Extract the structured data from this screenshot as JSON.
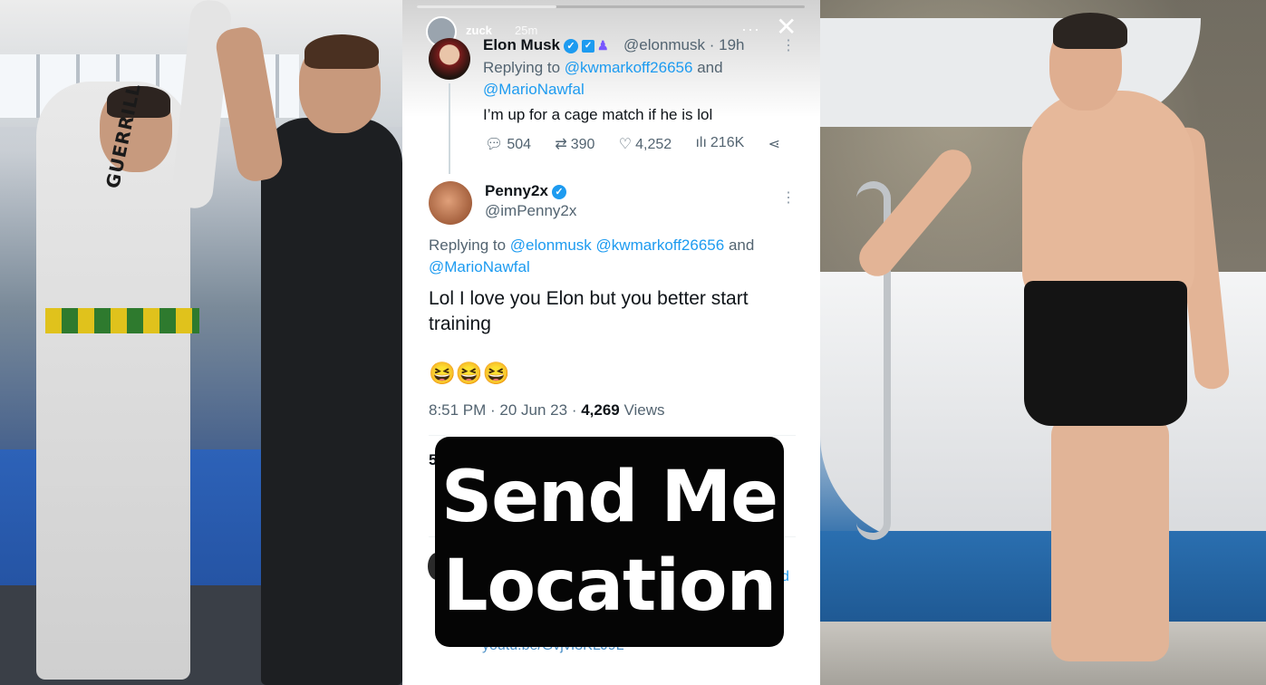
{
  "story": {
    "username": "zuck",
    "time": "25m",
    "progress": 0.36,
    "more_label": "···",
    "close_label": "✕"
  },
  "tweet1": {
    "name": "Elon Musk",
    "handle_time": "@elonmusk · 19h",
    "replying_prefix": "Replying to ",
    "replying_users": [
      "@kwmarkoff26656",
      "@MarioNawfal"
    ],
    "replying_and": " and",
    "text": "I’m up for a cage match if he is lol",
    "replies": "504",
    "retweets": "390",
    "likes": "4,252",
    "views": "216K"
  },
  "tweet2": {
    "name": "Penny2x",
    "handle": "@imPenny2x",
    "replying_prefix": "Replying to ",
    "replying_users": [
      "@elonmusk",
      "@kwmarkoff26656",
      "@MarioNawfal"
    ],
    "replying_and": " and",
    "text": "Lol I love you Elon but you better start training",
    "emojis": "😆😆😆",
    "meta_time": "8:51 PM · 20 Jun 23 · ",
    "meta_views_count": "4,269",
    "meta_views_label": " Views"
  },
  "peek": {
    "left_char": "5",
    "link_text": "youtu.be/GvjvI3KLJ9L",
    "right_char": "d"
  },
  "overlay": {
    "line1": "Send Me",
    "line2": "Location"
  },
  "photos": {
    "left_gi_text": "GUERRILL"
  },
  "colors": {
    "accent": "#1d9bf0",
    "overlay_bg": "#050505",
    "text_primary": "#0f1419",
    "text_secondary": "#536471"
  },
  "icons": [
    "reply-icon",
    "retweet-icon",
    "like-icon",
    "views-icon",
    "share-icon",
    "verified-icon",
    "close-icon",
    "more-icon"
  ]
}
